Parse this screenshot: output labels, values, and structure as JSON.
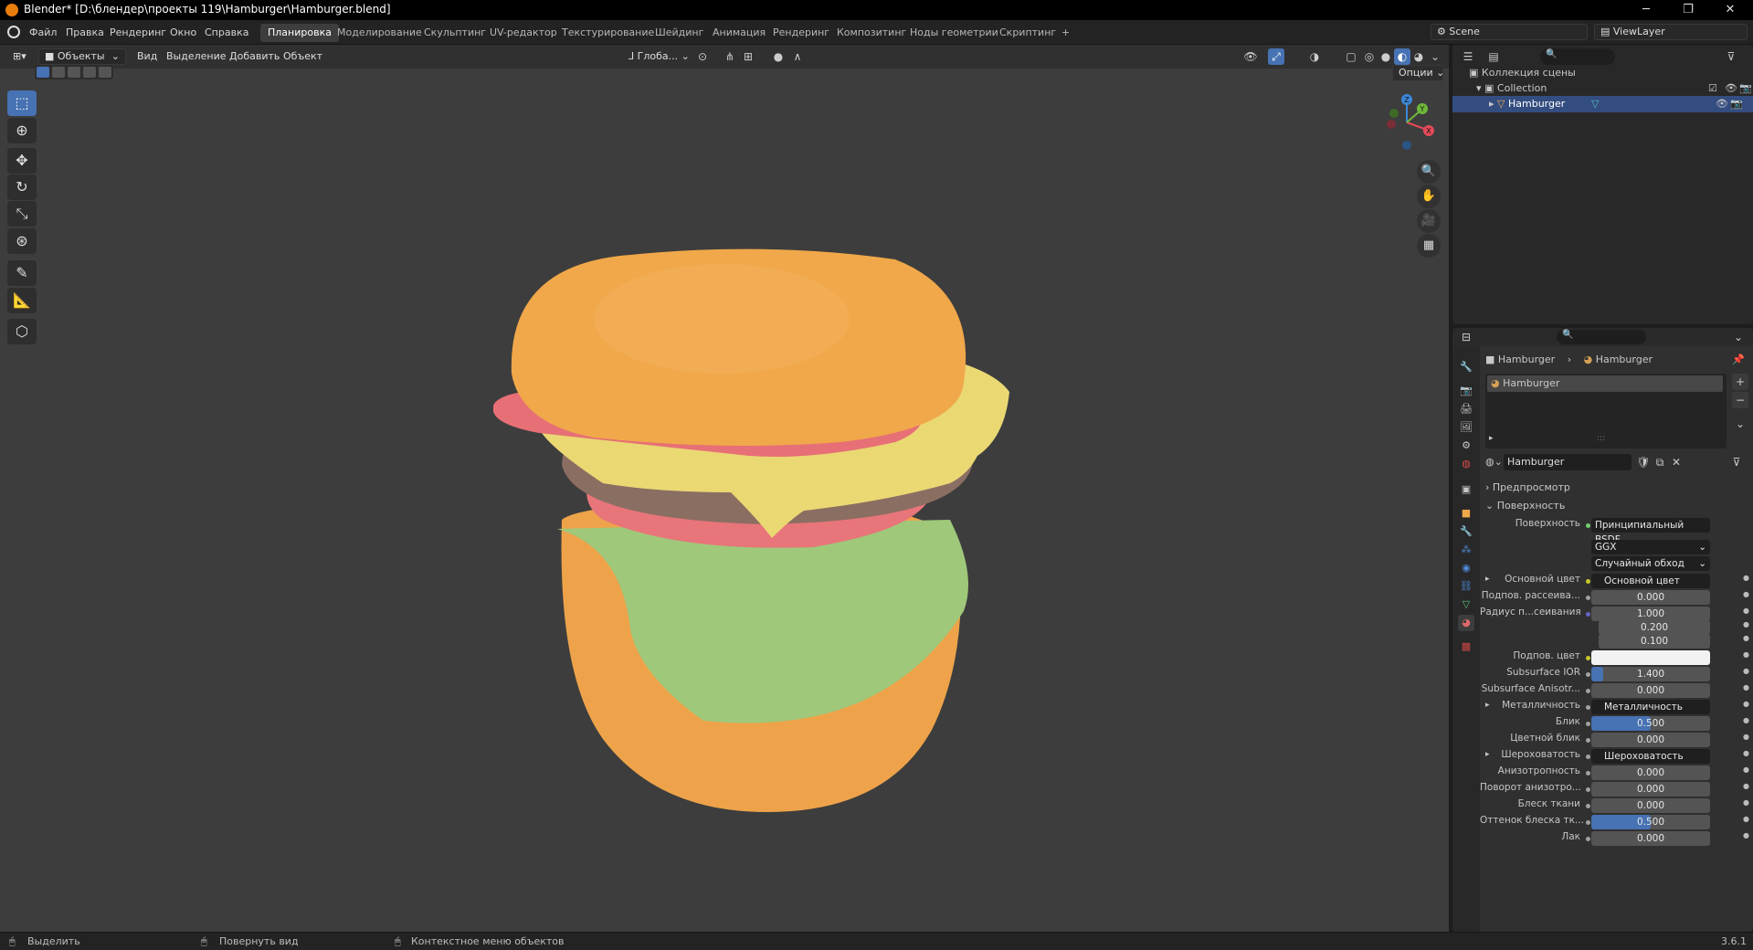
{
  "window": {
    "title": "Blender* [D:\\блендер\\проекты 119\\Hamburger\\Hamburger.blend]",
    "min": "─",
    "max": "❐",
    "close": "✕"
  },
  "menu": [
    "Файл",
    "Правка",
    "Рендеринг",
    "Окно",
    "Справка"
  ],
  "workspaces": [
    "Планировка",
    "Моделирование",
    "Скульптинг",
    "UV-редактор",
    "Текстурирование",
    "Шейдинг",
    "Анимация",
    "Рендеринг",
    "Композитинг",
    "Ноды геометрии",
    "Скриптинг"
  ],
  "add_workspace": "+",
  "scene": {
    "name": "Scene",
    "viewlayer": "ViewLayer"
  },
  "viewport_header": {
    "mode": "Объекты",
    "menus": [
      "Вид",
      "Выделение",
      "Добавить",
      "Объект"
    ],
    "orientation": "Глоба...",
    "options": "Опции"
  },
  "gizmo": {
    "x": "X",
    "y": "Y",
    "z": "Z"
  },
  "outliner": {
    "root": "Коллекция сцены",
    "collection": "Collection",
    "object": "Hamburger"
  },
  "properties": {
    "breadcrumb_object": "Hamburger",
    "breadcrumb_material": "Hamburger",
    "slot_name": "Hamburger",
    "material_name": "Hamburger",
    "panels": {
      "preview": "Предпросмотр",
      "surface": "Поверхность"
    },
    "surface_label": "Поверхность",
    "surface_value": "Принципиальный BSDF",
    "distribution": "GGX",
    "sss_method": "Случайный обход",
    "rows": [
      {
        "label": "Основной цвет",
        "value": "Основной цвет",
        "kind": "link"
      },
      {
        "label": "Подпов. рассеива...",
        "value": "0.000",
        "kind": "num"
      },
      {
        "label": "Радиус п...сеивания",
        "value": "1.000",
        "kind": "num"
      },
      {
        "label": "",
        "value": "0.200",
        "kind": "num"
      },
      {
        "label": "",
        "value": "0.100",
        "kind": "num"
      },
      {
        "label": "Подпов. цвет",
        "value": "",
        "kind": "color"
      },
      {
        "label": "Subsurface IOR",
        "value": "1.400",
        "kind": "num",
        "fill": 0.1
      },
      {
        "label": "Subsurface Anisotr...",
        "value": "0.000",
        "kind": "num"
      },
      {
        "label": "Металличность",
        "value": "Металличность",
        "kind": "link"
      },
      {
        "label": "Блик",
        "value": "0.500",
        "kind": "num",
        "fill": 0.5
      },
      {
        "label": "Цветной блик",
        "value": "0.000",
        "kind": "num"
      },
      {
        "label": "Шероховатость",
        "value": "Шероховатость",
        "kind": "link"
      },
      {
        "label": "Анизотропность",
        "value": "0.000",
        "kind": "num"
      },
      {
        "label": "Поворот анизотро...",
        "value": "0.000",
        "kind": "num"
      },
      {
        "label": "Блеск ткани",
        "value": "0.000",
        "kind": "num"
      },
      {
        "label": "Оттенок блеска тк...",
        "value": "0.500",
        "kind": "num",
        "fill": 0.5
      },
      {
        "label": "Лак",
        "value": "0.000",
        "kind": "num"
      }
    ]
  },
  "status": {
    "select": "Выделить",
    "rotate": "Повернуть вид",
    "context": "Контекстное меню объектов",
    "version": "3.6.1"
  },
  "colors": {
    "accent": "#4772b3",
    "bun": "#f0a84a",
    "cheese": "#ecd773",
    "tomato": "#e8737a",
    "patty": "#8a6a60",
    "lettuce": "#9cca76"
  }
}
